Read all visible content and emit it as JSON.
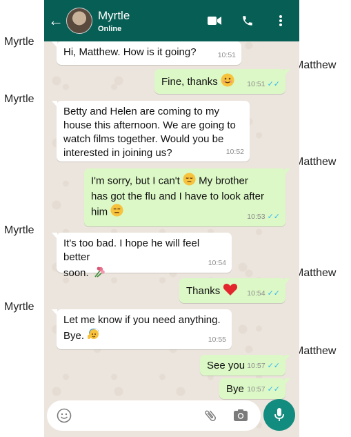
{
  "header": {
    "contact_name": "Myrtle",
    "status": "Online"
  },
  "messages": [
    {
      "sender": "Myrtle",
      "text": "Hi, Matthew. How is it going?",
      "time": "10:51"
    },
    {
      "sender": "Matthew",
      "text": "Fine, thanks",
      "time": "10:51"
    },
    {
      "sender": "Myrtle",
      "text_lines": [
        "Betty and Helen are coming to my",
        "house this afternoon. We are going to",
        "watch films together. Would you be",
        "interested in joining us?"
      ],
      "time": "10:52"
    },
    {
      "sender": "Matthew",
      "text_lines": [
        "I'm sorry, but I can't",
        "My brother",
        "has got the flu and I have to look after",
        "him"
      ],
      "time": "10:53"
    },
    {
      "sender": "Myrtle",
      "text_lines": [
        "It's too bad. I hope he will feel better",
        "soon."
      ],
      "time": "10:54"
    },
    {
      "sender": "Matthew",
      "text": "Thanks",
      "time": "10:54"
    },
    {
      "sender": "Myrtle",
      "text_lines": [
        "Let me know if you need anything.",
        "Bye."
      ],
      "time": "10:55"
    },
    {
      "sender": "Matthew",
      "text": "See you",
      "time": "10:57"
    },
    {
      "sender": "Matthew",
      "text": "Bye",
      "time": "10:57"
    }
  ],
  "sender_labels": {
    "myrtle": "Myrtle",
    "matthew": "Matthew"
  },
  "icons": {
    "back": "arrow-left-icon",
    "video": "video-camera-icon",
    "call": "phone-icon",
    "menu": "more-vertical-icon",
    "emoji": "smiley-icon",
    "attach": "paperclip-icon",
    "camera": "camera-icon",
    "mic": "microphone-icon"
  },
  "colors": {
    "header": "#075e54",
    "outgoing_bubble": "#dcf8c6",
    "incoming_bubble": "#ffffff",
    "chat_bg": "#ece5dd",
    "mic_button": "#128c7e",
    "read_ticks": "#34b7f1"
  }
}
